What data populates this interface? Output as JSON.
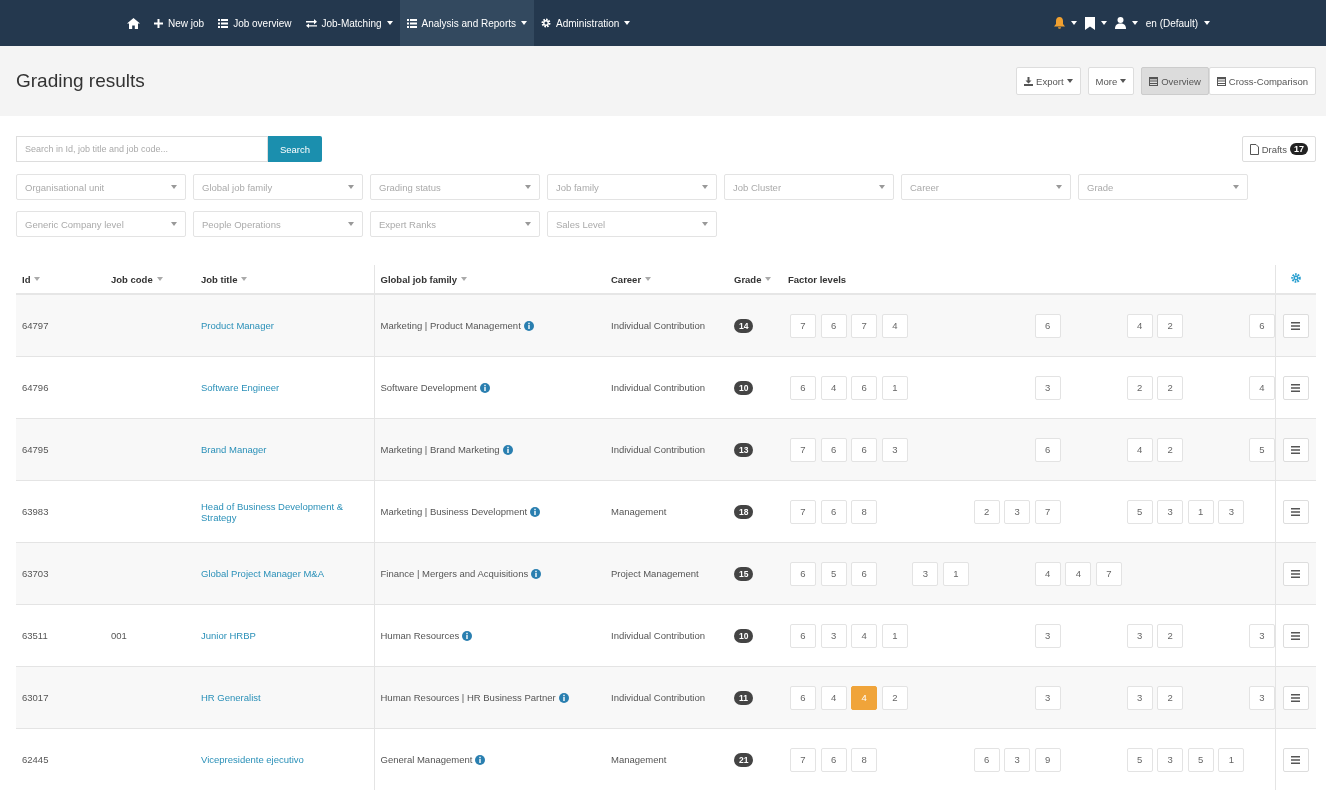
{
  "navbar": {
    "items": [
      {
        "dropdown": false,
        "selected": false
      },
      {
        "label": "New job",
        "dropdown": false,
        "selected": false
      },
      {
        "label": "Job overview",
        "dropdown": false,
        "selected": false
      },
      {
        "label": "Job-Matching",
        "dropdown": true,
        "selected": false
      },
      {
        "label": "Analysis and Reports",
        "dropdown": true,
        "selected": true
      },
      {
        "label": "Administration",
        "dropdown": true,
        "selected": false
      }
    ],
    "right_items": [
      {
        "dropdown": true
      },
      {
        "dropdown": true
      },
      {
        "dropdown": true
      },
      {
        "label": "en (Default)",
        "dropdown": true
      }
    ]
  },
  "page_title": "Grading results",
  "toolbar": {
    "actions": [
      {
        "label": "Export",
        "dropdown": true
      },
      {
        "label": "More",
        "dropdown": true
      }
    ],
    "views": [
      {
        "label": "Overview",
        "selected": true
      },
      {
        "label": "Cross-Comparison",
        "selected": false
      }
    ]
  },
  "search": {
    "placeholder": "Search in Id, job title and job code...",
    "button": "Search"
  },
  "drafts": {
    "label": "Drafts",
    "count": "17"
  },
  "filters": [
    [
      "Organisational unit",
      "Global job family",
      "Grading status",
      "Job family",
      "Job Cluster",
      "Career",
      "Grade"
    ],
    [
      "Generic Company level",
      "People Operations",
      "Expert Ranks",
      "Sales Level"
    ]
  ],
  "table": {
    "columns": [
      {
        "label": "Id",
        "sortable": true
      },
      {
        "label": "Job code",
        "sortable": true
      },
      {
        "label": "Job title",
        "sortable": true
      },
      {
        "label": "Global job family",
        "sortable": true
      },
      {
        "label": "Career",
        "sortable": true
      },
      {
        "label": "Grade",
        "sortable": true
      },
      {
        "label": "Factor levels",
        "sortable": false
      }
    ],
    "rows": [
      {
        "id": "64797",
        "job_title": "Product Manager",
        "global_job_family": "Marketing | Product Management",
        "info": true,
        "career": "Individual Contribution",
        "grade": "14",
        "factor_groups": [
          {
            "kind": "g1",
            "levels": [
              {
                "value": "7",
                "highlighted": false
              },
              {
                "value": "6",
                "highlighted": false
              },
              {
                "value": "7",
                "highlighted": false
              },
              {
                "value": "4",
                "highlighted": false
              }
            ]
          },
          {
            "kind": "g4",
            "levels": [
              {
                "value": "6",
                "highlighted": false
              }
            ]
          },
          {
            "kind": "g5",
            "levels": [
              {
                "value": "4",
                "highlighted": false
              },
              {
                "value": "2",
                "highlighted": false
              }
            ]
          },
          {
            "kind": "g6",
            "levels": [
              {
                "value": "6",
                "highlighted": false
              }
            ]
          }
        ]
      },
      {
        "id": "64796",
        "job_title": "Software Engineer",
        "global_job_family": "Software Development",
        "info": true,
        "career": "Individual Contribution",
        "grade": "10",
        "factor_groups": [
          {
            "kind": "g1",
            "levels": [
              {
                "value": "6",
                "highlighted": false
              },
              {
                "value": "4",
                "highlighted": false
              },
              {
                "value": "6",
                "highlighted": false
              },
              {
                "value": "1",
                "highlighted": false
              }
            ]
          },
          {
            "kind": "g4",
            "levels": [
              {
                "value": "3",
                "highlighted": false
              }
            ]
          },
          {
            "kind": "g5",
            "levels": [
              {
                "value": "2",
                "highlighted": false
              },
              {
                "value": "2",
                "highlighted": false
              }
            ]
          },
          {
            "kind": "g6",
            "levels": [
              {
                "value": "4",
                "highlighted": false
              }
            ]
          }
        ]
      },
      {
        "id": "64795",
        "job_title": "Brand Manager",
        "global_job_family": "Marketing | Brand Marketing",
        "info": true,
        "career": "Individual Contribution",
        "grade": "13",
        "factor_groups": [
          {
            "kind": "g1",
            "levels": [
              {
                "value": "7",
                "highlighted": false
              },
              {
                "value": "6",
                "highlighted": false
              },
              {
                "value": "6",
                "highlighted": false
              },
              {
                "value": "3",
                "highlighted": false
              }
            ]
          },
          {
            "kind": "g4",
            "levels": [
              {
                "value": "6",
                "highlighted": false
              }
            ]
          },
          {
            "kind": "g5",
            "levels": [
              {
                "value": "4",
                "highlighted": false
              },
              {
                "value": "2",
                "highlighted": false
              }
            ]
          },
          {
            "kind": "g6",
            "levels": [
              {
                "value": "5",
                "highlighted": false
              }
            ]
          }
        ]
      },
      {
        "id": "63983",
        "job_title": "Head of Business Development & Strategy",
        "global_job_family": "Marketing | Business Development",
        "info": true,
        "career": "Management",
        "grade": "18",
        "factor_groups": [
          {
            "kind": "g1",
            "levels": [
              {
                "value": "7",
                "highlighted": false
              },
              {
                "value": "6",
                "highlighted": false
              },
              {
                "value": "8",
                "highlighted": false
              }
            ]
          },
          {
            "kind": "g3",
            "levels": [
              {
                "value": "2",
                "highlighted": false
              },
              {
                "value": "3",
                "highlighted": false
              },
              {
                "value": "7",
                "highlighted": false
              }
            ]
          },
          {
            "kind": "g5",
            "levels": [
              {
                "value": "5",
                "highlighted": false
              },
              {
                "value": "3",
                "highlighted": false
              },
              {
                "value": "1",
                "highlighted": false
              },
              {
                "value": "3",
                "highlighted": false
              }
            ]
          }
        ]
      },
      {
        "id": "63703",
        "job_title": "Global Project Manager M&A",
        "global_job_family": "Finance | Mergers and Acquisitions",
        "info": true,
        "career": "Project Management",
        "grade": "15",
        "factor_groups": [
          {
            "kind": "g1",
            "levels": [
              {
                "value": "6",
                "highlighted": false
              },
              {
                "value": "5",
                "highlighted": false
              },
              {
                "value": "6",
                "highlighted": false
              }
            ]
          },
          {
            "kind": "g2",
            "levels": [
              {
                "value": "3",
                "highlighted": false
              },
              {
                "value": "1",
                "highlighted": false
              }
            ]
          },
          {
            "kind": "g4",
            "levels": [
              {
                "value": "4",
                "highlighted": false
              },
              {
                "value": "4",
                "highlighted": false
              },
              {
                "value": "7",
                "highlighted": false
              }
            ]
          }
        ]
      },
      {
        "id": "63511",
        "job_code": "001",
        "job_title": "Junior HRBP",
        "global_job_family": "Human Resources",
        "info": true,
        "career": "Individual Contribution",
        "grade": "10",
        "factor_groups": [
          {
            "kind": "g1",
            "levels": [
              {
                "value": "6",
                "highlighted": false
              },
              {
                "value": "3",
                "highlighted": false
              },
              {
                "value": "4",
                "highlighted": false
              },
              {
                "value": "1",
                "highlighted": false
              }
            ]
          },
          {
            "kind": "g4",
            "levels": [
              {
                "value": "3",
                "highlighted": false
              }
            ]
          },
          {
            "kind": "g5",
            "levels": [
              {
                "value": "3",
                "highlighted": false
              },
              {
                "value": "2",
                "highlighted": false
              }
            ]
          },
          {
            "kind": "g6",
            "levels": [
              {
                "value": "3",
                "highlighted": false
              }
            ]
          }
        ]
      },
      {
        "id": "63017",
        "job_title": "HR Generalist",
        "global_job_family": "Human Resources | HR Business Partner",
        "info": true,
        "career": "Individual Contribution",
        "grade": "11",
        "factor_groups": [
          {
            "kind": "g1",
            "levels": [
              {
                "value": "6",
                "highlighted": false
              },
              {
                "value": "4",
                "highlighted": false
              },
              {
                "value": "4",
                "highlighted": true
              },
              {
                "value": "2",
                "highlighted": false
              }
            ]
          },
          {
            "kind": "g4",
            "levels": [
              {
                "value": "3",
                "highlighted": false
              }
            ]
          },
          {
            "kind": "g5",
            "levels": [
              {
                "value": "3",
                "highlighted": false
              },
              {
                "value": "2",
                "highlighted": false
              }
            ]
          },
          {
            "kind": "g6",
            "levels": [
              {
                "value": "3",
                "highlighted": false
              }
            ]
          }
        ]
      },
      {
        "id": "62445",
        "job_title": "Vicepresidente ejecutivo",
        "global_job_family": "General Management",
        "info": true,
        "career": "Management",
        "grade": "21",
        "factor_groups": [
          {
            "kind": "g1",
            "levels": [
              {
                "value": "7",
                "highlighted": false
              },
              {
                "value": "6",
                "highlighted": false
              },
              {
                "value": "8",
                "highlighted": false
              }
            ]
          },
          {
            "kind": "g3",
            "levels": [
              {
                "value": "6",
                "highlighted": false
              },
              {
                "value": "3",
                "highlighted": false
              },
              {
                "value": "9",
                "highlighted": false
              }
            ]
          },
          {
            "kind": "g5",
            "levels": [
              {
                "value": "5",
                "highlighted": false
              },
              {
                "value": "3",
                "highlighted": false
              },
              {
                "value": "5",
                "highlighted": false
              },
              {
                "value": "1",
                "highlighted": false
              }
            ]
          }
        ]
      }
    ]
  }
}
